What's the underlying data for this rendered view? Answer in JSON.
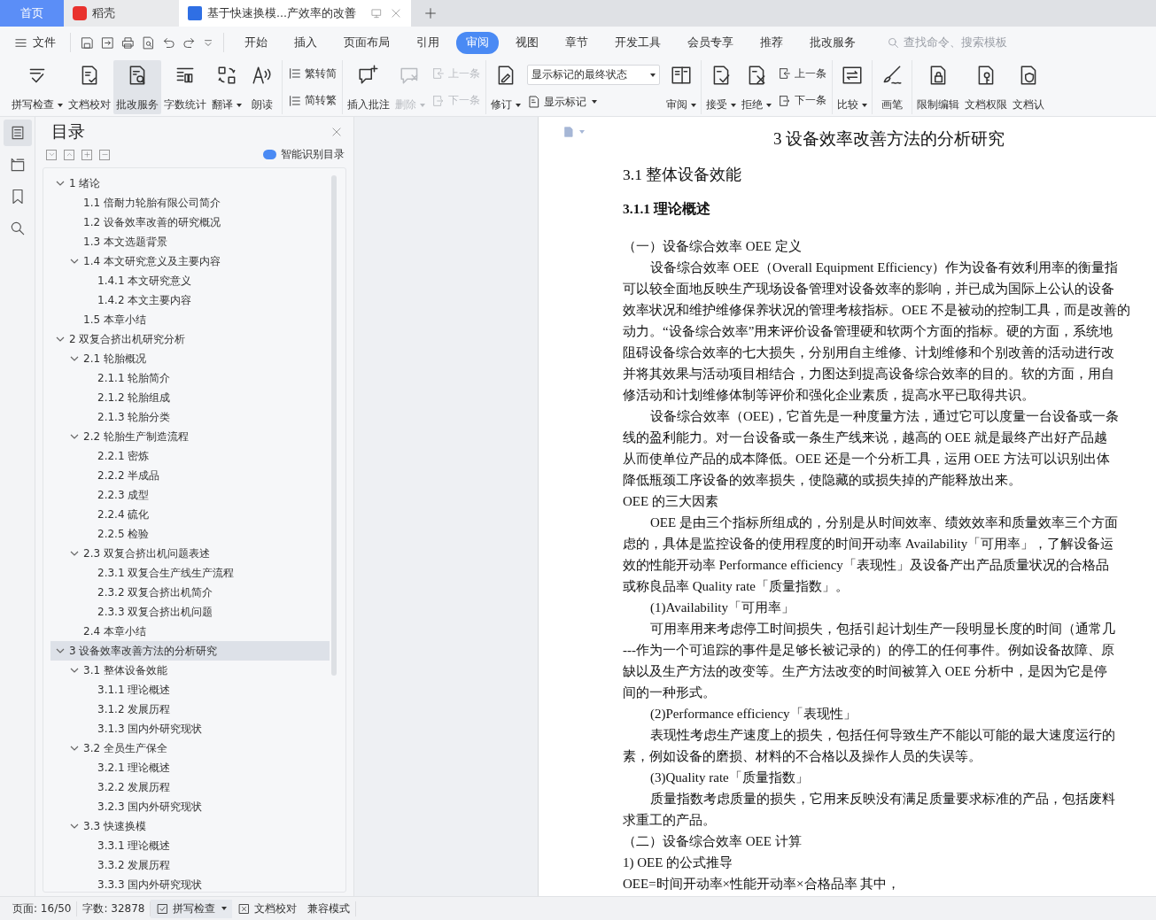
{
  "tabs": [
    {
      "kind": "home",
      "label": "首页",
      "selected": false
    },
    {
      "kind": "app",
      "label": "稻壳",
      "selected": false
    },
    {
      "kind": "document",
      "label": "基于快速换模...产效率的改善",
      "selected": true
    }
  ],
  "file_menu": {
    "label": "文件"
  },
  "menu_tabs": [
    {
      "label": "开始",
      "selected": false
    },
    {
      "label": "插入",
      "selected": false
    },
    {
      "label": "页面布局",
      "selected": false
    },
    {
      "label": "引用",
      "selected": false
    },
    {
      "label": "审阅",
      "selected": true
    },
    {
      "label": "视图",
      "selected": false
    },
    {
      "label": "章节",
      "selected": false
    },
    {
      "label": "开发工具",
      "selected": false
    },
    {
      "label": "会员专享",
      "selected": false
    },
    {
      "label": "推荐",
      "selected": false
    },
    {
      "label": "批改服务",
      "selected": false
    }
  ],
  "search": {
    "placeholder": "查找命令、搜索模板"
  },
  "ribbon_groups": [
    {
      "items": [
        {
          "kind": "large",
          "label": "拼写检查",
          "dropdown": true,
          "disabled": false,
          "highlighted": false
        },
        {
          "kind": "large",
          "label": "文档校对",
          "dropdown": false,
          "disabled": false,
          "highlighted": false
        },
        {
          "kind": "large",
          "label": "批改服务",
          "dropdown": false,
          "disabled": false,
          "highlighted": true
        },
        {
          "kind": "large",
          "label": "字数统计",
          "dropdown": false,
          "disabled": false,
          "highlighted": false
        },
        {
          "kind": "large",
          "label": "翻译",
          "dropdown": true,
          "disabled": false,
          "highlighted": false
        },
        {
          "kind": "large",
          "label": "朗读",
          "dropdown": false,
          "disabled": false,
          "highlighted": false
        }
      ]
    },
    {
      "items": [
        {
          "kind": "stack",
          "items": [
            {
              "label": "繁转简",
              "disabled": false
            },
            {
              "label": "简转繁",
              "disabled": false
            }
          ]
        }
      ]
    },
    {
      "items": [
        {
          "kind": "large",
          "label": "插入批注",
          "dropdown": false,
          "disabled": false,
          "highlighted": false
        },
        {
          "kind": "large",
          "label": "删除",
          "dropdown": true,
          "disabled": true,
          "highlighted": false
        },
        {
          "kind": "stack",
          "items": [
            {
              "label": "上一条",
              "disabled": true
            },
            {
              "label": "下一条",
              "disabled": true
            }
          ]
        }
      ]
    },
    {
      "items": [
        {
          "kind": "large",
          "label": "修订",
          "dropdown": true,
          "disabled": false,
          "highlighted": false
        },
        {
          "kind": "select",
          "value": "显示标记的最终状态",
          "below": "显示标记"
        },
        {
          "kind": "large",
          "label": "审阅",
          "dropdown": true,
          "disabled": false,
          "highlighted": false
        }
      ]
    },
    {
      "items": [
        {
          "kind": "large",
          "label": "接受",
          "dropdown": true,
          "disabled": false,
          "highlighted": false
        },
        {
          "kind": "large",
          "label": "拒绝",
          "dropdown": true,
          "disabled": false,
          "highlighted": false
        },
        {
          "kind": "stack",
          "items": [
            {
              "label": "上一条",
              "disabled": false
            },
            {
              "label": "下一条",
              "disabled": false
            }
          ]
        }
      ]
    },
    {
      "items": [
        {
          "kind": "large",
          "label": "比较",
          "dropdown": true,
          "disabled": false,
          "highlighted": false
        }
      ]
    },
    {
      "items": [
        {
          "kind": "large",
          "label": "画笔",
          "dropdown": false,
          "disabled": false,
          "highlighted": false
        }
      ]
    },
    {
      "items": [
        {
          "kind": "large",
          "label": "限制编辑",
          "dropdown": false,
          "disabled": false,
          "highlighted": false
        },
        {
          "kind": "large",
          "label": "文档权限",
          "dropdown": false,
          "disabled": false,
          "highlighted": false
        },
        {
          "kind": "large",
          "label": "文档认",
          "dropdown": false,
          "disabled": false,
          "highlighted": false
        }
      ]
    }
  ],
  "side_icons": [
    {
      "selected": true
    },
    {
      "selected": false
    },
    {
      "selected": false
    },
    {
      "selected": false
    }
  ],
  "toc": {
    "title": "目录",
    "smart_button": "智能识别目录",
    "items": [
      {
        "label": "1  绪论",
        "selected": false,
        "expanded": true,
        "children": [
          {
            "label": "1.1  倍耐力轮胎有限公司简介",
            "selected": false
          },
          {
            "label": "1.2  设备效率改善的研究概况",
            "selected": false
          },
          {
            "label": "1.3  本文选题背景",
            "selected": false
          },
          {
            "label": "1.4  本文研究意义及主要内容",
            "selected": false,
            "expanded": true,
            "children": [
              {
                "label": "1.4.1  本文研究意义",
                "selected": false
              },
              {
                "label": "1.4.2  本文主要内容",
                "selected": false
              }
            ]
          },
          {
            "label": "1.5  本章小结",
            "selected": false
          }
        ]
      },
      {
        "label": "2  双复合挤出机研究分析",
        "selected": false,
        "expanded": true,
        "children": [
          {
            "label": "2.1  轮胎概况",
            "selected": false,
            "expanded": true,
            "children": [
              {
                "label": "2.1.1  轮胎简介",
                "selected": false
              },
              {
                "label": "2.1.2  轮胎组成",
                "selected": false
              },
              {
                "label": "2.1.3  轮胎分类",
                "selected": false
              }
            ]
          },
          {
            "label": "2.2  轮胎生产制造流程",
            "selected": false,
            "expanded": true,
            "children": [
              {
                "label": "2.2.1  密炼",
                "selected": false
              },
              {
                "label": "2.2.2  半成品",
                "selected": false
              },
              {
                "label": "2.2.3  成型",
                "selected": false
              },
              {
                "label": "2.2.4  硫化",
                "selected": false
              },
              {
                "label": "2.2.5  检验",
                "selected": false
              }
            ]
          },
          {
            "label": "2.3  双复合挤出机问题表述",
            "selected": false,
            "expanded": true,
            "children": [
              {
                "label": "2.3.1  双复合生产线生产流程",
                "selected": false
              },
              {
                "label": "2.3.2  双复合挤出机简介",
                "selected": false
              },
              {
                "label": "2.3.3  双复合挤出机问题",
                "selected": false
              }
            ]
          },
          {
            "label": "2.4  本章小结",
            "selected": false
          }
        ]
      },
      {
        "label": "3  设备效率改善方法的分析研究",
        "selected": true,
        "expanded": true,
        "children": [
          {
            "label": "3.1  整体设备效能",
            "selected": false,
            "expanded": true,
            "children": [
              {
                "label": "3.1.1  理论概述",
                "selected": false
              },
              {
                "label": "3.1.2  发展历程",
                "selected": false
              },
              {
                "label": "3.1.3  国内外研究现状",
                "selected": false
              }
            ]
          },
          {
            "label": "3.2  全员生产保全",
            "selected": false,
            "expanded": true,
            "children": [
              {
                "label": "3.2.1  理论概述",
                "selected": false
              },
              {
                "label": "3.2.2  发展历程",
                "selected": false
              },
              {
                "label": "3.2.3  国内外研究现状",
                "selected": false
              }
            ]
          },
          {
            "label": "3.3  快速换模",
            "selected": false,
            "expanded": true,
            "children": [
              {
                "label": "3.3.1  理论概述",
                "selected": false
              },
              {
                "label": "3.3.2  发展历程",
                "selected": false
              },
              {
                "label": "3.3.3  国内外研究现状",
                "selected": false
              }
            ]
          }
        ]
      }
    ]
  },
  "document": {
    "lines": [
      {
        "kind": "title",
        "text": "3  设备效率改善方法的分析研究"
      },
      {
        "kind": "h2",
        "text": "3.1  整体设备效能"
      },
      {
        "kind": "h3",
        "text": "3.1.1  理论概述"
      },
      {
        "kind": "text",
        "text": "（一）设备综合效率  OEE  定义"
      },
      {
        "kind": "indent",
        "text": "设备综合效率  OEE（Overall Equipment Efficiency）作为设备有效利用率的衡量指"
      },
      {
        "kind": "text",
        "text": "可以较全面地反映生产现场设备管理对设备效率的影响，并已成为国际上公认的设备"
      },
      {
        "kind": "text",
        "text": "效率状况和维护维修保养状况的管理考核指标。OEE 不是被动的控制工具，而是改善的"
      },
      {
        "kind": "text",
        "text": "动力。“设备综合效率”用来评价设备管理硬和软两个方面的指标。硬的方面，系统地"
      },
      {
        "kind": "text",
        "text": "阻碍设备综合效率的七大损失，分别用自主维修、计划维修和个别改善的活动进行改"
      },
      {
        "kind": "text",
        "text": "并将其效果与活动项目相结合，力图达到提高设备综合效率的目的。软的方面，用自"
      },
      {
        "kind": "text",
        "text": "修活动和计划维修体制等评价和强化企业素质，提高水平已取得共识。"
      },
      {
        "kind": "indent",
        "text": "设备综合效率（OEE)，它首先是一种度量方法，通过它可以度量一台设备或一条"
      },
      {
        "kind": "text",
        "text": "线的盈利能力。对一台设备或一条生产线来说，越高的  OEE 就是最终产出好产品越"
      },
      {
        "kind": "text",
        "text": "从而使单位产品的成本降低。OEE 还是一个分析工具，运用  OEE 方法可以识别出体"
      },
      {
        "kind": "text",
        "text": "降低瓶颈工序设备的效率损失，使隐藏的或损失掉的产能释放出来。"
      },
      {
        "kind": "text",
        "text": "OEE  的三大因素"
      },
      {
        "kind": "indent",
        "text": "OEE  是由三个指标所组成的，分别是从时间效率、绩效效率和质量效率三个方面"
      },
      {
        "kind": "text",
        "text": "虑的，具体是监控设备的使用程度的时间开动率  Availability「可用率」，了解设备运"
      },
      {
        "kind": "text",
        "text": "效的性能开动率  Performance efficiency「表现性」及设备产出产品质量状况的合格品"
      },
      {
        "kind": "text",
        "text": "或称良品率  Quality rate「质量指数」。"
      },
      {
        "kind": "indent",
        "text": "(1)Availability「可用率」"
      },
      {
        "kind": "indent",
        "text": "可用率用来考虑停工时间损失，包括引起计划生产一段明显长度的时间（通常几"
      },
      {
        "kind": "text",
        "text": "---作为一个可追踪的事件是足够长被记录的）的停工的任何事件。例如设备故障、原"
      },
      {
        "kind": "text",
        "text": "缺以及生产方法的改变等。生产方法改变的时间被算入  OEE 分析中，是因为它是停"
      },
      {
        "kind": "text",
        "text": "间的一种形式。"
      },
      {
        "kind": "indent",
        "text": "(2)Performance efficiency「表现性」"
      },
      {
        "kind": "indent",
        "text": "表现性考虑生产速度上的损失，包括任何导致生产不能以可能的最大速度运行的"
      },
      {
        "kind": "text",
        "text": "素，例如设备的磨损、材料的不合格以及操作人员的失误等。"
      },
      {
        "kind": "indent",
        "text": "(3)Quality rate「质量指数」"
      },
      {
        "kind": "indent",
        "text": "质量指数考虑质量的损失，它用来反映没有满足质量要求标准的产品，包括废料"
      },
      {
        "kind": "text",
        "text": "求重工的产品。"
      },
      {
        "kind": "text",
        "text": "（二）设备综合效率  OEE  计算"
      },
      {
        "kind": "text",
        "text": "1) OEE  的公式推导"
      },
      {
        "kind": "text",
        "text": "OEE=时间开动率×性能开动率×合格品率  其中，"
      }
    ]
  },
  "status_bar": {
    "page": "页面: 16/50",
    "words": "字数: 32878",
    "spell": "拼写检查",
    "proof": "文档校对",
    "mode": "兼容模式"
  }
}
